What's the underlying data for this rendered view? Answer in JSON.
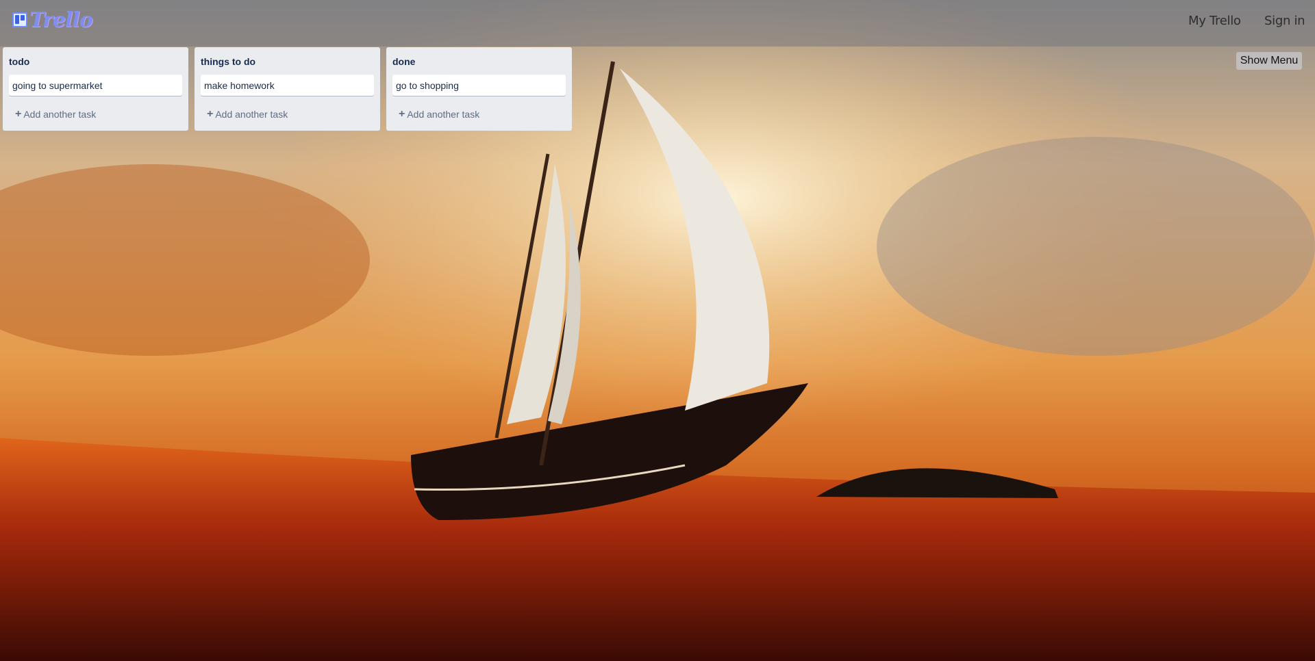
{
  "header": {
    "logo_text": "Trello",
    "nav": {
      "my_trello": "My Trello",
      "sign_in": "Sign in"
    }
  },
  "board": {
    "show_menu_label": "Show Menu",
    "lists": [
      {
        "title": "todo",
        "cards": [
          "going to supermarket"
        ],
        "add_label": "Add another task"
      },
      {
        "title": "things to do",
        "cards": [
          "make homework"
        ],
        "add_label": "Add another task"
      },
      {
        "title": "done",
        "cards": [
          "go to shopping"
        ],
        "add_label": "Add another task"
      }
    ]
  },
  "icons": {
    "logo": "trello-board-icon",
    "add": "plus-icon"
  },
  "colors": {
    "list_bg": "#ebecf0",
    "card_bg": "#ffffff",
    "title_text": "#172b4d",
    "muted_text": "#5e6c84"
  }
}
